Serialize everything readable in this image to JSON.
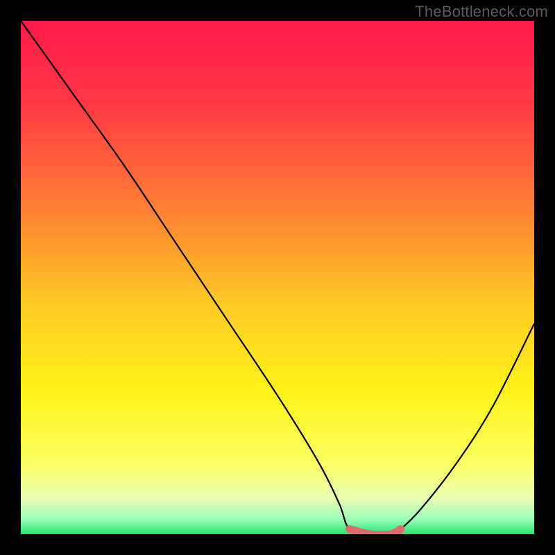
{
  "watermark": "TheBottleneck.com",
  "chart_data": {
    "type": "line",
    "title": "",
    "xlabel": "",
    "ylabel": "",
    "xlim": [
      0,
      100
    ],
    "ylim": [
      0,
      100
    ],
    "grid": false,
    "legend": false,
    "series": [
      {
        "name": "bottleneck-curve",
        "x": [
          0,
          10,
          20,
          30,
          40,
          50,
          58,
          62,
          64,
          68,
          72,
          74,
          78,
          85,
          92,
          100
        ],
        "values": [
          100,
          86,
          72,
          57,
          42,
          27,
          14,
          6,
          1,
          0,
          0,
          1,
          5,
          14,
          25,
          41
        ]
      },
      {
        "name": "highlight-segment",
        "x": [
          64,
          68,
          72,
          74
        ],
        "values": [
          1,
          0,
          0,
          1
        ]
      }
    ],
    "background_gradient": {
      "stops": [
        {
          "offset": 0.0,
          "color": "#ff1a4b"
        },
        {
          "offset": 0.15,
          "color": "#ff3545"
        },
        {
          "offset": 0.35,
          "color": "#ff7a34"
        },
        {
          "offset": 0.55,
          "color": "#ffc926"
        },
        {
          "offset": 0.72,
          "color": "#fff31a"
        },
        {
          "offset": 0.86,
          "color": "#fbff60"
        },
        {
          "offset": 0.93,
          "color": "#e7ffb0"
        },
        {
          "offset": 0.97,
          "color": "#9cffb8"
        },
        {
          "offset": 1.0,
          "color": "#28e56f"
        }
      ]
    },
    "highlight_color": "#e06a6a"
  }
}
